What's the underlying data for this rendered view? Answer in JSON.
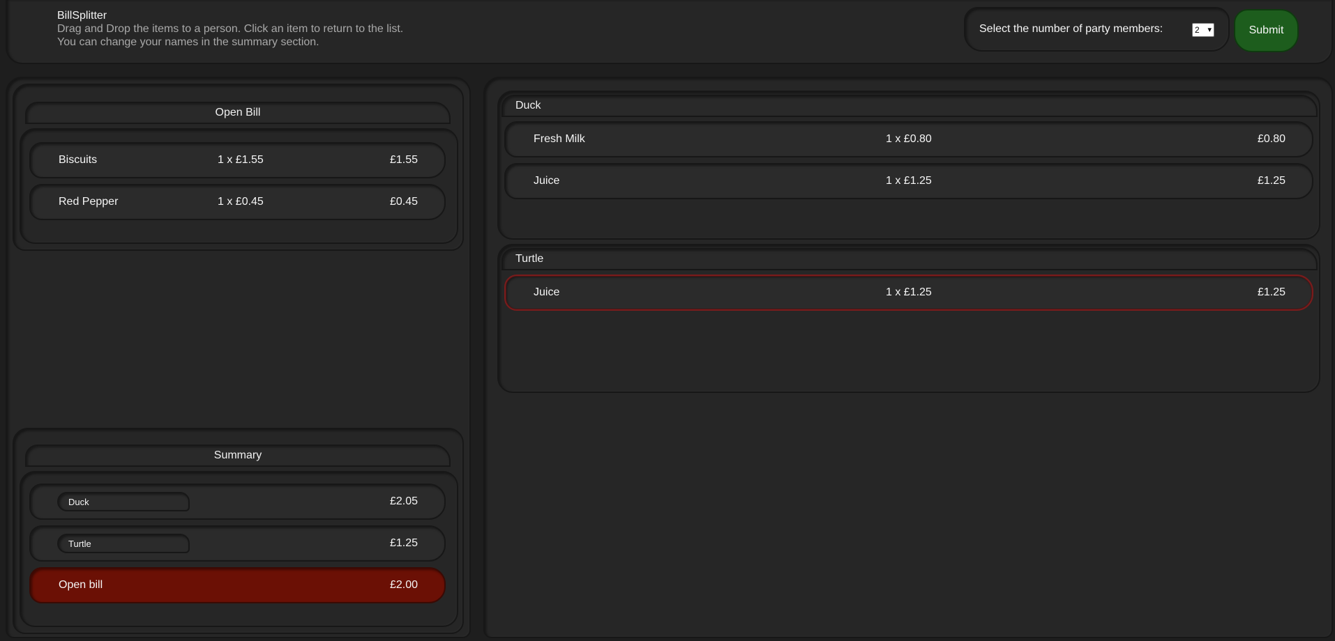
{
  "header": {
    "app_title": "BillSplitter",
    "instruction_line1": "Drag and Drop the items to a person. Click an item to return to the list.",
    "instruction_line2": "You can change your names in the summary section.",
    "members_label": "Select the number of party members:",
    "members_value": "2",
    "submit_label": "Submit"
  },
  "open_bill": {
    "title": "Open Bill",
    "items": [
      {
        "name": "Biscuits",
        "qty": "1 x £1.55",
        "total": "£1.55"
      },
      {
        "name": "Red Pepper",
        "qty": "1 x £0.45",
        "total": "£0.45"
      }
    ]
  },
  "summary": {
    "title": "Summary",
    "people": [
      {
        "name": "Duck",
        "total": "£2.05"
      },
      {
        "name": "Turtle",
        "total": "£1.25"
      }
    ],
    "open_bill_label": "Open bill",
    "open_bill_total": "£2.00"
  },
  "persons": [
    {
      "name": "Duck",
      "items": [
        {
          "name": "Fresh Milk",
          "qty": "1 x £0.80",
          "total": "£0.80"
        },
        {
          "name": "Juice",
          "qty": "1 x £1.25",
          "total": "£1.25"
        }
      ]
    },
    {
      "name": "Turtle",
      "items": [
        {
          "name": "Juice",
          "qty": "1 x £1.25",
          "total": "£1.25"
        }
      ]
    }
  ],
  "colors": {
    "background": "#1e1e1e",
    "panel": "#262626",
    "submit": "#1d5d1d",
    "open_bill_highlight": "#6b1005",
    "selected_border": "#7a1c1c"
  }
}
